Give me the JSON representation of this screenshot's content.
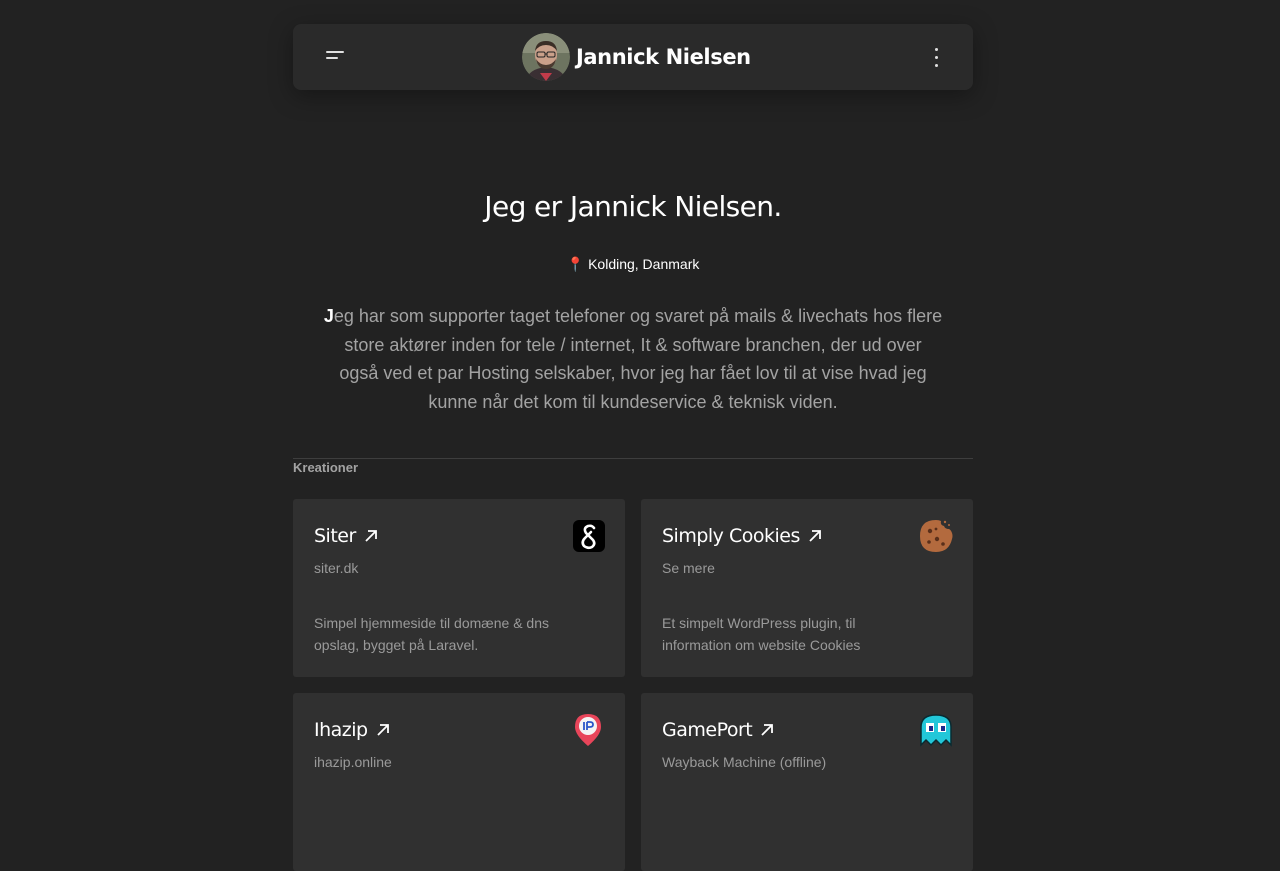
{
  "header": {
    "name": "Jannick Nielsen"
  },
  "hero": {
    "title": "Jeg er Jannick Nielsen.",
    "location": "Kolding, Danmark",
    "bio_first": "J",
    "bio_rest": "eg har som supporter taget telefoner og svaret på mails & livechats hos flere store aktører inden for tele / internet, It & software branchen, der ud over også ved et par Hosting selskaber, hvor jeg har fået lov til at vise hvad jeg kunne når det kom til kundeservice & teknisk viden."
  },
  "section": {
    "label": "Kreationer"
  },
  "cards": [
    {
      "title": "Siter",
      "subtitle": "siter.dk",
      "description": "Simpel hjemmeside til domæne & dns opslag, bygget på Laravel.",
      "icon": "siter-logo-icon"
    },
    {
      "title": "Simply Cookies",
      "subtitle": "Se mere",
      "description": "Et simpelt WordPress plugin, til information om website Cookies",
      "icon": "cookie-icon"
    },
    {
      "title": "Ihazip",
      "subtitle": "ihazip.online",
      "description": "",
      "icon": "ip-pin-icon"
    },
    {
      "title": "GamePort",
      "subtitle": "Wayback Machine (offline)",
      "description": "",
      "icon": "pacman-ghost-icon"
    }
  ],
  "colors": {
    "background": "#222222",
    "surface": "#2a2a2a",
    "card": "#303030",
    "text": "#ffffff",
    "muted": "#a3a3a3",
    "cookie": "#b36a3e",
    "ghost": "#22c7d9",
    "pin": "#e8455a"
  }
}
